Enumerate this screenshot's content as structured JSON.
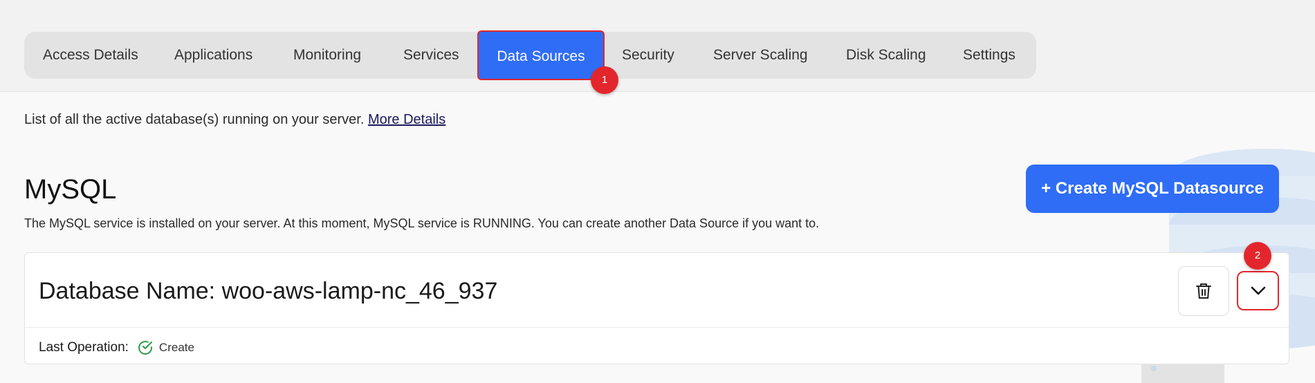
{
  "tabs": [
    {
      "label": "Access Details"
    },
    {
      "label": "Applications"
    },
    {
      "label": "Monitoring"
    },
    {
      "label": "Services"
    },
    {
      "label": "Data Sources",
      "active": true
    },
    {
      "label": "Security"
    },
    {
      "label": "Server Scaling"
    },
    {
      "label": "Disk Scaling"
    },
    {
      "label": "Settings"
    }
  ],
  "markers": [
    "1",
    "2"
  ],
  "intro": {
    "text": "List of all the active database(s) running on your server.",
    "link": "More Details"
  },
  "mysql": {
    "heading": "MySQL",
    "description": "The MySQL service is installed on your server. At this moment, MySQL service is RUNNING. You can create another Data Source if you want to.",
    "create_button": "+ Create MySQL Datasource"
  },
  "database": {
    "name": "Database Name: woo-aws-lamp-nc_46_937",
    "last_operation_label": "Last Operation:",
    "last_operation_value": "Create"
  },
  "colors": {
    "accent": "#2f6df6",
    "marker": "#e3262c",
    "success": "#2e9a48"
  },
  "icons": [
    "trash-icon",
    "chevron-down-icon",
    "check-circle-icon",
    "database-stack-icon"
  ]
}
